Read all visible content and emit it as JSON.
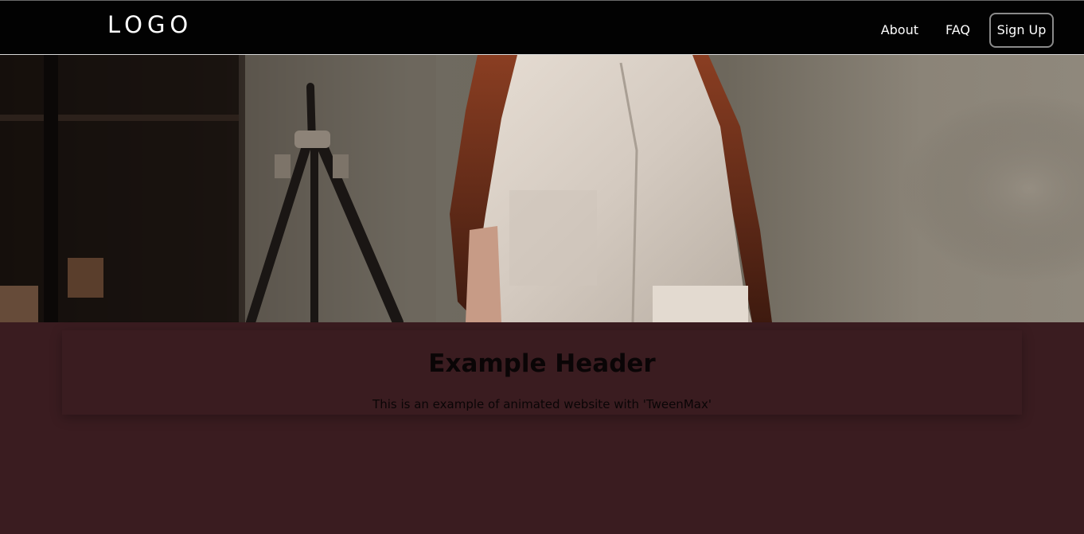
{
  "navbar": {
    "logo": "LOGO",
    "links": [
      "About",
      "FAQ"
    ],
    "signup_label": "Sign Up"
  },
  "hero": {
    "image": "woman-in-white-shirt-photo"
  },
  "card": {
    "title": "Example Header",
    "text": "This is an example of animated website with 'TweenMax'"
  },
  "colors": {
    "navbar_bg": "#020202",
    "page_bg": "#3a1c20",
    "nav_text": "#ffffff",
    "button_border": "#8a8a8a",
    "card_text": "#0a0506"
  }
}
